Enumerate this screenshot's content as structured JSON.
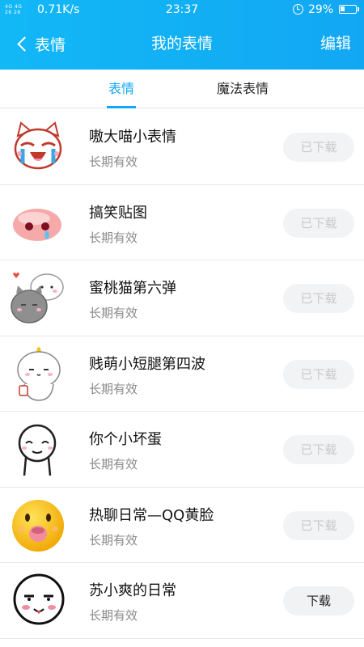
{
  "status_bar": {
    "signal_top": "4G 4G",
    "signal_bottom": "26 26",
    "network_speed": "0.71K/s",
    "time": "23:37",
    "battery_text": "29%",
    "battery_level": 0.29
  },
  "nav": {
    "back_label": "表情",
    "title": "我的表情",
    "edit_label": "编辑"
  },
  "tabs": [
    {
      "label": "表情",
      "active": true
    },
    {
      "label": "魔法表情",
      "active": false
    }
  ],
  "accent_color": "#12a7f3",
  "items": [
    {
      "name": "嗷大喵小表情",
      "subtitle": "长期有效",
      "button": "已下载",
      "downloaded": true,
      "icon": "crying-cat-icon"
    },
    {
      "name": "搞笑贴图",
      "subtitle": "长期有效",
      "button": "已下载",
      "downloaded": true,
      "icon": "pink-blob-icon"
    },
    {
      "name": "蜜桃猫第六弹",
      "subtitle": "长期有效",
      "button": "已下载",
      "downloaded": true,
      "icon": "peach-cats-icon"
    },
    {
      "name": "贱萌小短腿第四波",
      "subtitle": "长期有效",
      "button": "已下载",
      "downloaded": true,
      "icon": "chubby-character-icon"
    },
    {
      "name": "你个小坏蛋",
      "subtitle": "长期有效",
      "button": "已下载",
      "downloaded": true,
      "icon": "smirk-face-icon"
    },
    {
      "name": "热聊日常—QQ黄脸",
      "subtitle": "长期有效",
      "button": "已下载",
      "downloaded": true,
      "icon": "qq-yellow-face-icon"
    },
    {
      "name": "苏小爽的日常",
      "subtitle": "长期有效",
      "button": "下载",
      "downloaded": false,
      "icon": "white-face-icon"
    }
  ]
}
